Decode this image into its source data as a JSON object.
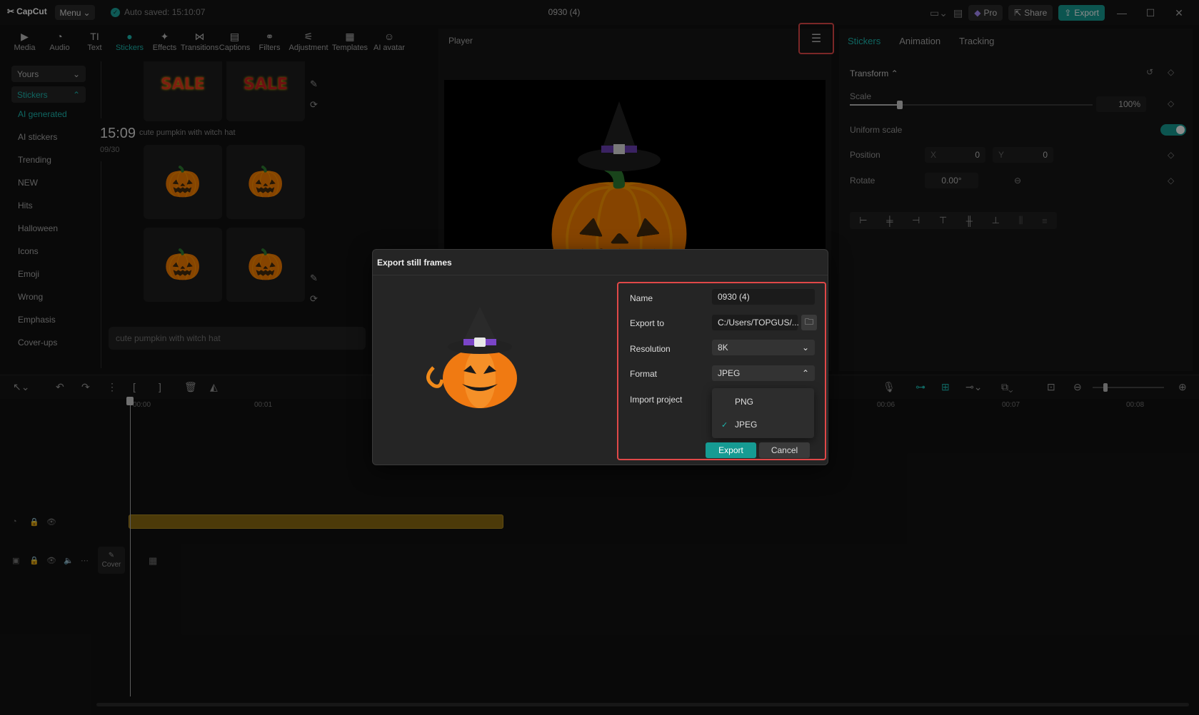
{
  "titlebar": {
    "app_name": "CapCut",
    "menu_label": "Menu",
    "autosave": "Auto saved: 15:10:07",
    "project_title": "0930 (4)",
    "pro_label": "Pro",
    "share_label": "Share",
    "export_label": "Export"
  },
  "tools": [
    {
      "label": "Media",
      "icon": "media-icon"
    },
    {
      "label": "Audio",
      "icon": "audio-icon"
    },
    {
      "label": "Text",
      "icon": "text-icon"
    },
    {
      "label": "Stickers",
      "icon": "stickers-icon"
    },
    {
      "label": "Effects",
      "icon": "effects-icon"
    },
    {
      "label": "Transitions",
      "icon": "transitions-icon"
    },
    {
      "label": "Captions",
      "icon": "captions-icon"
    },
    {
      "label": "Filters",
      "icon": "filters-icon"
    },
    {
      "label": "Adjustment",
      "icon": "adjustment-icon"
    },
    {
      "label": "Templates",
      "icon": "templates-icon"
    },
    {
      "label": "AI avatar",
      "icon": "ai-avatar-icon"
    }
  ],
  "leftnav": {
    "dropdown_yours": "Yours",
    "dropdown_stickers": "Stickers",
    "items": [
      "AI generated",
      "AI stickers",
      "Trending",
      "NEW",
      "Hits",
      "Halloween",
      "Icons",
      "Emoji",
      "Wrong",
      "Emphasis",
      "Cover-ups"
    ]
  },
  "stickers": {
    "sale_label": "SALE",
    "time": "15:09",
    "date": "09/30",
    "prompt": "cute pumpkin with witch hat",
    "search_placeholder": "cute pumpkin with witch hat"
  },
  "player": {
    "title": "Player"
  },
  "right_panel": {
    "tabs": [
      "Stickers",
      "Animation",
      "Tracking"
    ],
    "transform_label": "Transform",
    "scale_label": "Scale",
    "scale_value": "100%",
    "uniform_scale_label": "Uniform scale",
    "position_label": "Position",
    "x_label": "X",
    "x_value": "0",
    "y_label": "Y",
    "y_value": "0",
    "rotate_label": "Rotate",
    "rotate_value": "0.00°"
  },
  "timeline": {
    "ticks": [
      "00:00",
      "00:01",
      "00:06",
      "00:07",
      "00:08"
    ],
    "cover_label": "Cover"
  },
  "dialog": {
    "title": "Export still frames",
    "name_label": "Name",
    "name_value": "0930 (4)",
    "export_to_label": "Export to",
    "export_to_value": "C:/Users/TOPGUS/...",
    "resolution_label": "Resolution",
    "resolution_value": "8K",
    "format_label": "Format",
    "format_value": "JPEG",
    "import_project_label": "Import project",
    "format_options": [
      "PNG",
      "JPEG"
    ],
    "selected_option": "JPEG",
    "export_button": "Export",
    "cancel_button": "Cancel"
  },
  "colors": {
    "accent": "#1cb8b0",
    "highlight_border": "#e04848",
    "clip": "#8a6a12"
  }
}
